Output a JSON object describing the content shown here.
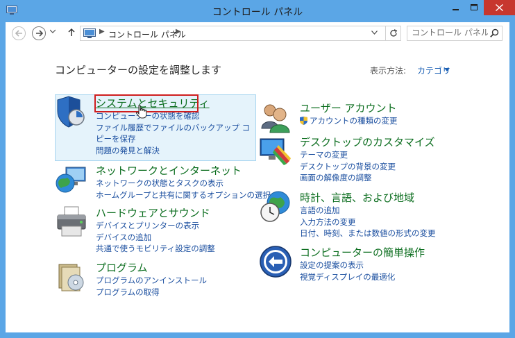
{
  "window": {
    "title": "コントロール パネル",
    "accent": "#5ba6e6",
    "close_color": "#c7372e"
  },
  "address_bar": {
    "path_label": "コントロール パネル",
    "search_placeholder": "コントロール パネル..."
  },
  "page": {
    "heading": "コンピューターの設定を調整します",
    "view_by_label": "表示方法:",
    "view_by_value": "カテゴリ"
  },
  "categories_left": [
    {
      "title": "システムとセキュリティ",
      "icon": "shield-icon",
      "links": [
        "コンピューターの状態を確認",
        "ファイル履歴でファイルのバックアップ コピーを保存",
        "問題の発見と解決"
      ]
    },
    {
      "title": "ネットワークとインターネット",
      "icon": "network-globe-icon",
      "links": [
        "ネットワークの状態とタスクの表示",
        "ホームグループと共有に関するオプションの選択"
      ]
    },
    {
      "title": "ハードウェアとサウンド",
      "icon": "printer-icon",
      "links": [
        "デバイスとプリンターの表示",
        "デバイスの追加",
        "共通で使うモビリティ設定の調整"
      ]
    },
    {
      "title": "プログラム",
      "icon": "programs-icon",
      "links": [
        "プログラムのアンインストール",
        "プログラムの取得"
      ]
    }
  ],
  "categories_right": [
    {
      "title": "ユーザー アカウント",
      "icon": "users-icon",
      "links": [
        "アカウントの種類の変更"
      ]
    },
    {
      "title": "デスクトップのカスタマイズ",
      "icon": "desktop-customize-icon",
      "links": [
        "テーマの変更",
        "デスクトップの背景の変更",
        "画面の解像度の調整"
      ]
    },
    {
      "title": "時計、言語、および地域",
      "icon": "clock-globe-icon",
      "links": [
        "言語の追加",
        "入力方法の変更",
        "日付、時刻、または数値の形式の変更"
      ]
    },
    {
      "title": "コンピューターの簡単操作",
      "icon": "ease-of-access-icon",
      "links": [
        "設定の提案の表示",
        "視覚ディスプレイの最適化"
      ]
    }
  ]
}
